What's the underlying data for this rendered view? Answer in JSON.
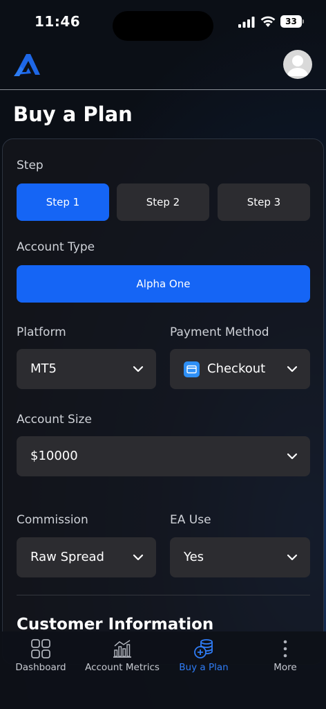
{
  "status_bar": {
    "time": "11:46",
    "battery": "33"
  },
  "header": {
    "logo_icon": "brand-logo-icon",
    "avatar_icon": "user-avatar-icon"
  },
  "page": {
    "title": "Buy a Plan"
  },
  "form": {
    "step_label": "Step",
    "steps": [
      {
        "label": "Step 1",
        "active": true
      },
      {
        "label": "Step 2",
        "active": false
      },
      {
        "label": "Step 3",
        "active": false
      }
    ],
    "account_type_label": "Account Type",
    "account_type_value": "Alpha One",
    "platform_label": "Platform",
    "platform_value": "MT5",
    "payment_label": "Payment Method",
    "payment_value": "Checkout",
    "account_size_label": "Account Size",
    "account_size_value": "$10000",
    "commission_label": "Commission",
    "commission_value": "Raw Spread",
    "ea_label": "EA Use",
    "ea_value": "Yes",
    "customer_info_title": "Customer Information"
  },
  "tabs": [
    {
      "label": "Dashboard",
      "icon": "grid-icon",
      "active": false
    },
    {
      "label": "Account Metrics",
      "icon": "chart-icon",
      "active": false
    },
    {
      "label": "Buy a Plan",
      "icon": "coins-icon",
      "active": true
    },
    {
      "label": "More",
      "icon": "more-icon",
      "active": false
    }
  ],
  "colors": {
    "accent": "#1565f5",
    "tab_active": "#2f7cf6",
    "field_bg": "#2c2c30"
  }
}
